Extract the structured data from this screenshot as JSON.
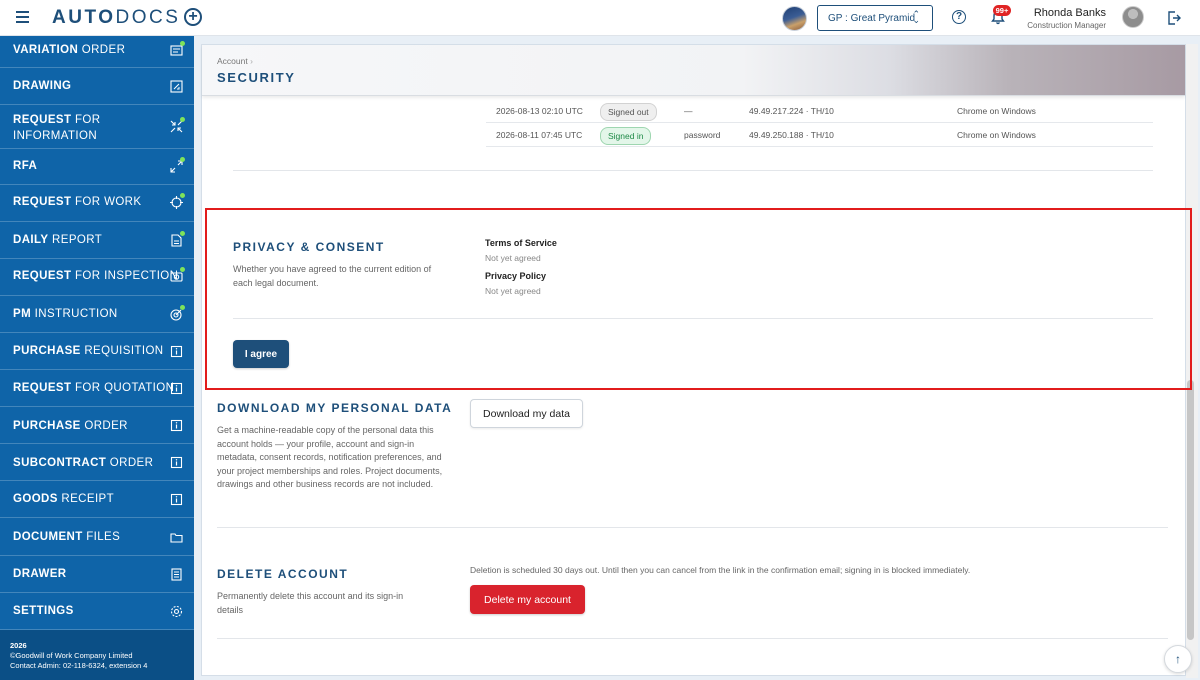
{
  "header": {
    "brand_bold": "AUTO",
    "brand_light": "DOCS",
    "project_selector": "GP : Great Pyramid",
    "notification_count": "99+",
    "user_name": "Rhonda Banks",
    "user_role": "Construction Manager"
  },
  "sidebar": {
    "items": [
      {
        "bold": "VARIATION",
        "rest": " ORDER",
        "icon": "variation-icon",
        "dot": true
      },
      {
        "bold": "DRAWING",
        "rest": "",
        "icon": "drawing-icon",
        "dot": false
      },
      {
        "bold": "REQUEST",
        "rest": " FOR",
        "line2": "INFORMATION",
        "icon": "collapse-arrows-icon",
        "dot": true
      },
      {
        "bold": "RFA",
        "rest": "",
        "icon": "expand-arrows-icon",
        "dot": true
      },
      {
        "bold": "REQUEST",
        "rest": " FOR WORK",
        "icon": "crosshair-icon",
        "dot": true
      },
      {
        "bold": "DAILY",
        "rest": " REPORT",
        "icon": "report-icon",
        "dot": true
      },
      {
        "bold": "REQUEST",
        "rest": " FOR INSPECTION",
        "icon": "camera-icon",
        "dot": true
      },
      {
        "bold": "PM",
        "rest": " INSTRUCTION",
        "icon": "target-icon",
        "dot": true
      },
      {
        "bold": "PURCHASE",
        "rest": " REQUISITION",
        "icon": "doc-info-icon",
        "dot": false
      },
      {
        "bold": "REQUEST",
        "rest": " FOR QUOTATION",
        "icon": "doc-info-icon",
        "dot": false
      },
      {
        "bold": "PURCHASE",
        "rest": " ORDER",
        "icon": "doc-info-icon",
        "dot": false
      },
      {
        "bold": "SUBCONTRACT",
        "rest": " ORDER",
        "icon": "doc-info-icon",
        "dot": false
      },
      {
        "bold": "GOODS",
        "rest": " RECEIPT",
        "icon": "doc-info-icon",
        "dot": false
      },
      {
        "bold": "DOCUMENT",
        "rest": " FILES",
        "icon": "folder-icon",
        "dot": false
      },
      {
        "bold": "DRAWER",
        "rest": "",
        "icon": "drawer-icon",
        "dot": false
      },
      {
        "bold": "SETTINGS",
        "rest": "",
        "icon": "gear-icon",
        "dot": false
      }
    ],
    "footer_year": "2026",
    "footer_company": "©Goodwill of Work Company Limited",
    "footer_contact": "Contact Admin: 02-118-6324, extension 4"
  },
  "page": {
    "breadcrumb": "Account",
    "breadcrumb_sep": "›",
    "title": "SECURITY"
  },
  "sessions": [
    {
      "time": "2026-08-13 02:10 UTC",
      "status": "Signed out",
      "status_kind": "out",
      "method": "—",
      "ip": "49.49.217.224 · TH/10",
      "device": "Chrome on Windows"
    },
    {
      "time": "2026-08-11 07:45 UTC",
      "status": "Signed in",
      "status_kind": "in",
      "method": "password",
      "ip": "49.49.250.188 · TH/10",
      "device": "Chrome on Windows"
    }
  ],
  "privacy": {
    "title": "PRIVACY & CONSENT",
    "description": "Whether you have agreed to the current edition of each legal document.",
    "tos_label": "Terms of Service",
    "tos_value": "Not yet agreed",
    "pp_label": "Privacy Policy",
    "pp_value": "Not yet agreed",
    "agree_button": "I agree"
  },
  "download": {
    "title": "DOWNLOAD MY PERSONAL DATA",
    "description": "Get a machine-readable copy of the personal data this account holds — your profile, account and sign-in metadata, consent records, notification preferences, and your project memberships and roles. Project documents, drawings and other business records are not included.",
    "button": "Download my data"
  },
  "delete": {
    "title": "DELETE ACCOUNT",
    "description": "Permanently delete this account and its sign-in details",
    "note": "Deletion is scheduled 30 days out. Until then you can cancel from the link in the confirmation email; signing in is blocked immediately.",
    "button": "Delete my account"
  },
  "colors": {
    "brand": "#1e4f7a",
    "sidebar": "#0f64a8",
    "danger": "#d9232d",
    "highlight": "#e21c1c",
    "status_dot": "#7ee35a"
  }
}
